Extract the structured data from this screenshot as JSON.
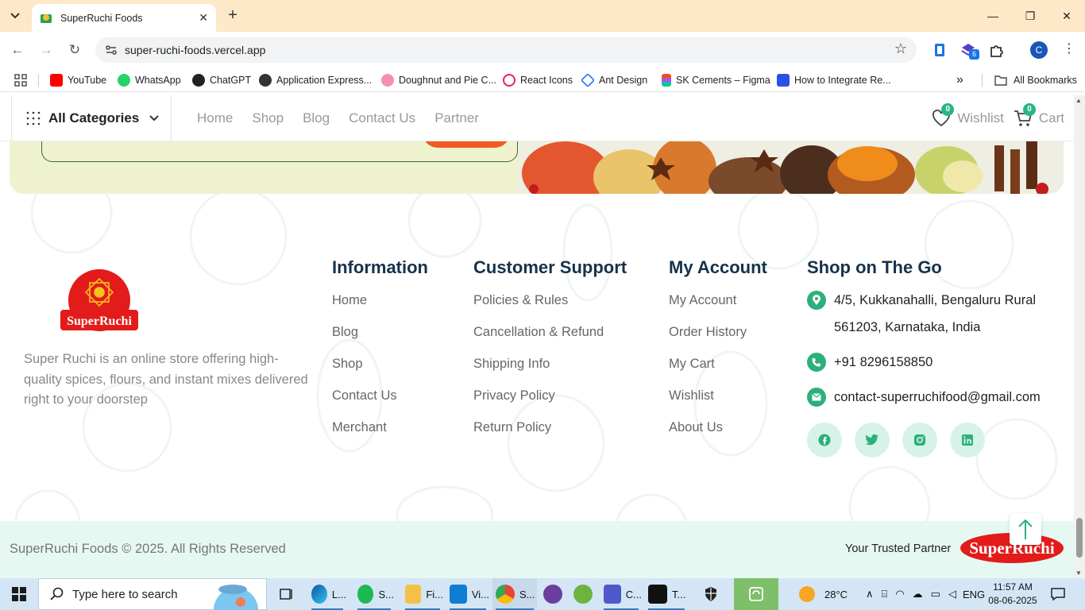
{
  "browser": {
    "tab_title": "SuperRuchi Foods",
    "url": "super-ruchi-foods.vercel.app",
    "extension_badge": "6",
    "profile_initial": "C",
    "bookmarks": [
      "YouTube",
      "WhatsApp",
      "ChatGPT",
      "Application Express...",
      "Doughnut and Pie C...",
      "React Icons",
      "Ant Design",
      "SK Cements – Figma",
      "How to Integrate Re..."
    ],
    "all_bookmarks": "All Bookmarks"
  },
  "header": {
    "all_categories": "All Categories",
    "nav": [
      "Home",
      "Shop",
      "Blog",
      "Contact Us",
      "Partner"
    ],
    "wishlist_label": "Wishlist",
    "wishlist_count": "0",
    "cart_label": "Cart",
    "cart_count": "0"
  },
  "footer": {
    "logo_text": "SuperRuchi",
    "description": "Super Ruchi is an online store offering high-quality spices, flours, and instant mixes delivered right to your doorstep",
    "information": {
      "title": "Information",
      "links": [
        "Home",
        "Blog",
        "Shop",
        "Contact Us",
        "Merchant"
      ]
    },
    "customer_support": {
      "title": "Customer Support",
      "links": [
        "Policies & Rules",
        "Cancellation & Refund",
        "Shipping Info",
        "Privacy Policy",
        "Return Policy"
      ]
    },
    "my_account": {
      "title": "My Account",
      "links": [
        "My Account",
        "Order History",
        "My Cart",
        "Wishlist",
        "About Us"
      ]
    },
    "shop_on_the_go": {
      "title": "Shop on The Go",
      "address_line1": "4/5, Kukkanahalli, Bengaluru Rural",
      "address_line2": "561203, Karnataka, India",
      "phone": "+91 8296158850",
      "email": "contact-superruchifood@gmail.com"
    },
    "copyright": "SuperRuchi Foods © 2025. All Rights Reserved",
    "tagline": "Your Trusted Partner"
  },
  "taskbar": {
    "search_placeholder": "Type here to search",
    "apps": [
      {
        "label": "L..."
      },
      {
        "label": "S..."
      },
      {
        "label": "Fi..."
      },
      {
        "label": "Vi..."
      },
      {
        "label": "S..."
      },
      {
        "label": "C..."
      },
      {
        "label": "T..."
      }
    ],
    "weather": "28°C",
    "language": "ENG",
    "time": "11:57 AM",
    "date": "08-06-2025"
  },
  "colors": {
    "accent_green": "#2cb07b",
    "brand_red": "#e31b1b",
    "heading_navy": "#17324a",
    "tab_bar": "#fde8c8"
  }
}
